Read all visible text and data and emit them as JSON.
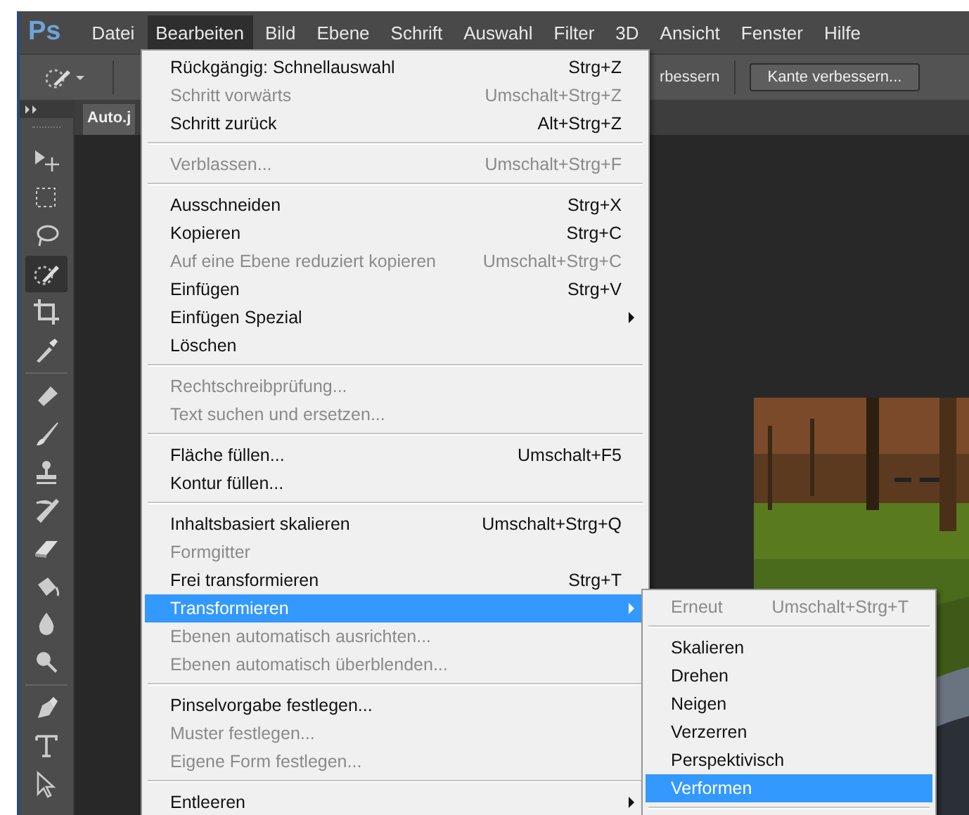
{
  "app_logo": "Ps",
  "menubar": [
    {
      "label": "Datei",
      "selected": false
    },
    {
      "label": "Bearbeiten",
      "selected": true
    },
    {
      "label": "Bild",
      "selected": false
    },
    {
      "label": "Ebene",
      "selected": false
    },
    {
      "label": "Schrift",
      "selected": false
    },
    {
      "label": "Auswahl",
      "selected": false
    },
    {
      "label": "Filter",
      "selected": false
    },
    {
      "label": "3D",
      "selected": false
    },
    {
      "label": "Ansicht",
      "selected": false
    },
    {
      "label": "Fenster",
      "selected": false
    },
    {
      "label": "Hilfe",
      "selected": false
    }
  ],
  "options_bar": {
    "partial_text": "rbessern",
    "button": "Kante verbessern..."
  },
  "document_tab": {
    "title": "Auto.j"
  },
  "tools": [
    {
      "kind": "move",
      "selected": false
    },
    {
      "kind": "marquee",
      "selected": false
    },
    {
      "kind": "lasso",
      "selected": false
    },
    {
      "kind": "quick-select",
      "selected": true
    },
    {
      "kind": "crop",
      "selected": false
    },
    {
      "kind": "eyedropper",
      "selected": false
    },
    {
      "kind": "divider"
    },
    {
      "kind": "healing",
      "selected": false
    },
    {
      "kind": "brush",
      "selected": false
    },
    {
      "kind": "stamp",
      "selected": false
    },
    {
      "kind": "history-brush",
      "selected": false
    },
    {
      "kind": "eraser",
      "selected": false
    },
    {
      "kind": "bucket",
      "selected": false
    },
    {
      "kind": "blur",
      "selected": false
    },
    {
      "kind": "dodge",
      "selected": false
    },
    {
      "kind": "divider"
    },
    {
      "kind": "pen",
      "selected": false
    },
    {
      "kind": "type",
      "selected": false
    },
    {
      "kind": "path-select",
      "selected": false
    }
  ],
  "edit_menu": [
    {
      "kind": "item",
      "label": "Rückgängig: Schnellauswahl",
      "shortcut": "Strg+Z",
      "disabled": false,
      "submenu": false,
      "selected": false
    },
    {
      "kind": "item",
      "label": "Schritt vorwärts",
      "shortcut": "Umschalt+Strg+Z",
      "disabled": true,
      "submenu": false,
      "selected": false
    },
    {
      "kind": "item",
      "label": "Schritt zurück",
      "shortcut": "Alt+Strg+Z",
      "disabled": false,
      "submenu": false,
      "selected": false
    },
    {
      "kind": "separator"
    },
    {
      "kind": "item",
      "label": "Verblassen...",
      "shortcut": "Umschalt+Strg+F",
      "disabled": true,
      "submenu": false,
      "selected": false
    },
    {
      "kind": "separator"
    },
    {
      "kind": "item",
      "label": "Ausschneiden",
      "shortcut": "Strg+X",
      "disabled": false,
      "submenu": false,
      "selected": false
    },
    {
      "kind": "item",
      "label": "Kopieren",
      "shortcut": "Strg+C",
      "disabled": false,
      "submenu": false,
      "selected": false
    },
    {
      "kind": "item",
      "label": "Auf eine Ebene reduziert kopieren",
      "shortcut": "Umschalt+Strg+C",
      "disabled": true,
      "submenu": false,
      "selected": false
    },
    {
      "kind": "item",
      "label": "Einfügen",
      "shortcut": "Strg+V",
      "disabled": false,
      "submenu": false,
      "selected": false
    },
    {
      "kind": "item",
      "label": "Einfügen Spezial",
      "disabled": false,
      "submenu": true,
      "selected": false
    },
    {
      "kind": "item",
      "label": "Löschen",
      "disabled": false,
      "submenu": false,
      "selected": false
    },
    {
      "kind": "separator"
    },
    {
      "kind": "item",
      "label": "Rechtschreibprüfung...",
      "disabled": true,
      "submenu": false,
      "selected": false
    },
    {
      "kind": "item",
      "label": "Text suchen und ersetzen...",
      "disabled": true,
      "submenu": false,
      "selected": false
    },
    {
      "kind": "separator"
    },
    {
      "kind": "item",
      "label": "Fläche füllen...",
      "shortcut": "Umschalt+F5",
      "disabled": false,
      "submenu": false,
      "selected": false
    },
    {
      "kind": "item",
      "label": "Kontur füllen...",
      "disabled": false,
      "submenu": false,
      "selected": false
    },
    {
      "kind": "separator"
    },
    {
      "kind": "item",
      "label": "Inhaltsbasiert skalieren",
      "shortcut": "Umschalt+Strg+Q",
      "disabled": false,
      "submenu": false,
      "selected": false
    },
    {
      "kind": "item",
      "label": "Formgitter",
      "disabled": true,
      "submenu": false,
      "selected": false
    },
    {
      "kind": "item",
      "label": "Frei transformieren",
      "shortcut": "Strg+T",
      "disabled": false,
      "submenu": false,
      "selected": false
    },
    {
      "kind": "item",
      "label": "Transformieren",
      "disabled": false,
      "submenu": true,
      "selected": true
    },
    {
      "kind": "item",
      "label": "Ebenen automatisch ausrichten...",
      "disabled": true,
      "submenu": false,
      "selected": false
    },
    {
      "kind": "item",
      "label": "Ebenen automatisch überblenden...",
      "disabled": true,
      "submenu": false,
      "selected": false
    },
    {
      "kind": "separator"
    },
    {
      "kind": "item",
      "label": "Pinselvorgabe festlegen...",
      "disabled": false,
      "submenu": false,
      "selected": false
    },
    {
      "kind": "item",
      "label": "Muster festlegen...",
      "disabled": true,
      "submenu": false,
      "selected": false
    },
    {
      "kind": "item",
      "label": "Eigene Form festlegen...",
      "disabled": true,
      "submenu": false,
      "selected": false
    },
    {
      "kind": "separator"
    },
    {
      "kind": "item",
      "label": "Entleeren",
      "disabled": false,
      "submenu": true,
      "selected": false
    }
  ],
  "transform_submenu": [
    {
      "kind": "item",
      "label": "Erneut",
      "shortcut": "Umschalt+Strg+T",
      "disabled": true,
      "selected": false
    },
    {
      "kind": "separator"
    },
    {
      "kind": "item",
      "label": "Skalieren",
      "disabled": false,
      "selected": false
    },
    {
      "kind": "item",
      "label": "Drehen",
      "disabled": false,
      "selected": false
    },
    {
      "kind": "item",
      "label": "Neigen",
      "disabled": false,
      "selected": false
    },
    {
      "kind": "item",
      "label": "Verzerren",
      "disabled": false,
      "selected": false
    },
    {
      "kind": "item",
      "label": "Perspektivisch",
      "disabled": false,
      "selected": false
    },
    {
      "kind": "item",
      "label": "Verformen",
      "disabled": false,
      "selected": true
    },
    {
      "kind": "separator"
    }
  ]
}
